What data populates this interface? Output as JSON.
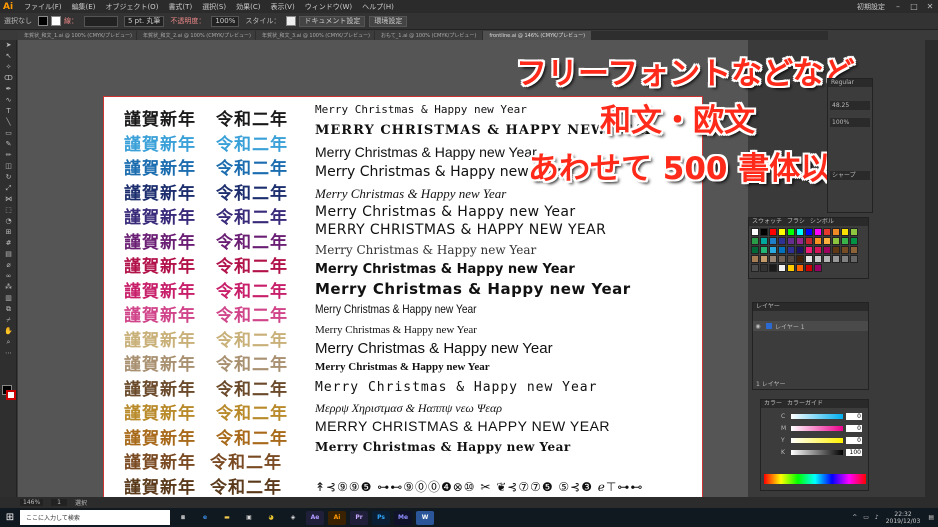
{
  "app": {
    "logo": "Ai",
    "menus": [
      "ファイル(F)",
      "編集(E)",
      "オブジェクト(O)",
      "書式(T)",
      "選択(S)",
      "効果(C)",
      "表示(V)",
      "ウィンドウ(W)",
      "ヘルプ(H)"
    ],
    "workspace": "初期設定"
  },
  "control": {
    "selection": "選択なし",
    "stroke_label": "線：",
    "stroke_value": "5 pt. 丸筆",
    "opacity_label": "不透明度：",
    "opacity_value": "100%",
    "style_label": "スタイル：",
    "doc_setup": "ドキュメント設定",
    "prefs": "環境設定"
  },
  "tabs": [
    "年賀状_和文_1.ai @ 100% (CMYK/プレビュー)",
    "年賀状_和文_2.ai @ 100% (CMYK/プレビュー)",
    "年賀状_和文_3.ai @ 100% (CMYK/プレビュー)",
    "おもて_1.ai @ 100% (CMYK/プレビュー)",
    "frontline.ai @ 146% (CMYK/プレビュー)"
  ],
  "artboard": {
    "jp_left": [
      {
        "text": "謹賀新年",
        "color": "#1a1a1a"
      },
      {
        "text": "謹賀新年",
        "color": "#3aa0d8"
      },
      {
        "text": "謹賀新年",
        "color": "#1b6db0"
      },
      {
        "text": "謹賀新年",
        "color": "#1d2e6e"
      },
      {
        "text": "謹賀新年",
        "color": "#3a2a7a"
      },
      {
        "text": "謹賀新年",
        "color": "#6a1f74"
      },
      {
        "text": "謹賀新年",
        "color": "#b2124a"
      },
      {
        "text": "謹賀新年",
        "color": "#c71f6a"
      },
      {
        "text": "謹賀新年",
        "color": "#d0448a"
      },
      {
        "text": "謹賀新年",
        "color": "#c8b078"
      },
      {
        "text": "謹賀新年",
        "color": "#a89070"
      },
      {
        "text": "謹賀新年",
        "color": "#6a4a2a"
      },
      {
        "text": "謹賀新年",
        "color": "#b88a2a"
      },
      {
        "text": "謹賀新年",
        "color": "#a86a1a"
      },
      {
        "text": "謹賀新年",
        "color": "#7a4a22"
      },
      {
        "text": "謹賀新年",
        "color": "#5a3a1a"
      },
      {
        "text": "謹賀新年",
        "color": "#3a2a1a"
      }
    ],
    "jp_right": [
      {
        "text": "令和二年",
        "color": "#1a1a1a"
      },
      {
        "text": "令和二年",
        "color": "#3aa0d8"
      },
      {
        "text": "令和二年",
        "color": "#1b6db0"
      },
      {
        "text": "令和二年",
        "color": "#1d2e6e"
      },
      {
        "text": "令和二年",
        "color": "#3a2a7a"
      },
      {
        "text": "令和二年",
        "color": "#6a1f74"
      },
      {
        "text": "令和二年",
        "color": "#b2124a"
      },
      {
        "text": "令和二年",
        "color": "#c71f6a"
      },
      {
        "text": "令和二年",
        "color": "#d0448a"
      },
      {
        "text": "令和二年",
        "color": "#c8b078"
      },
      {
        "text": "令和二年",
        "color": "#a89070"
      },
      {
        "text": "令和二年",
        "color": "#6a4a2a"
      },
      {
        "text": "令和二年",
        "color": "#b88a2a"
      },
      {
        "text": "令和二年",
        "color": "#a86a1a"
      },
      {
        "text": "令和二年",
        "color": "#7a4a22"
      },
      {
        "text": "令和二年",
        "color": "#5a3a1a"
      },
      {
        "text": "令和二年",
        "color": "#3a2a1a"
      }
    ],
    "english": [
      "Merry Christmas &  Happy new Year",
      "MERRY CHRISTMAS & HAPPY NEW YEAR",
      "Merry Christmas & Happy new Year",
      "Merry Christmas & Happy new Year",
      "Merry Christmas & Happy new Year",
      "Merry Christmas & Happy new Year",
      "MERRY CHRISTMAS & HAPPY NEW YEAR",
      "Merry Christmas & Happy new Year",
      "Merry Christmas & Happy new Year",
      "Merry Christmas & Happy new Year",
      "Merry Christmas & Happy new Year",
      "Merry Christmas & Happy new Year",
      "Merry Christmas & Happy new Year",
      "Merry Christmas & Happy new Year",
      "Merry Christmas & Happy new Year",
      "Μερρψ Χηριστμασ & Ηαππψ νεω Ψεαρ",
      "MERRY CHRISTMAS & HAPPY NEW YEAR",
      "Merry Christmas & Happy new Year"
    ],
    "dingbats_1": "↟⊰⑨⑨❺   ⊶⊷⑨⓪⓪❹⊗⑩   ✂   ❦⊰⑦⑦❺   ⑤⊰❸   ℯ⊤⊶⊷",
    "dingbats_2": "↺⇨△△◢   ⇤↑△↓▽◀⊳▷   ↗   ⇆⇨▲▲◢   ⇔⇨▷   ∰⊰∰"
  },
  "overlay": {
    "line1": "フリーフォントなどなど",
    "line2": "和文・欧文",
    "line3": "あわせて 500 書体以上"
  },
  "panels": {
    "regular": "Regular",
    "font_size": "48.25",
    "tracking": "100%",
    "sharp": "シャープ",
    "swatches_tabs": [
      "スウォッチ",
      "ブラシ",
      "シンボル"
    ],
    "layers_title": "レイヤー",
    "layer_name": "レイヤー 1",
    "layer_count": "1 レイヤー",
    "color_tabs": [
      "カラー",
      "カラーガイド"
    ],
    "cmyk": [
      {
        "ch": "C",
        "val": "0"
      },
      {
        "ch": "M",
        "val": "0"
      },
      {
        "ch": "Y",
        "val": "0"
      },
      {
        "ch": "K",
        "val": "100"
      }
    ]
  },
  "status": {
    "zoom": "146%",
    "page": "1",
    "tool": "選択"
  },
  "taskbar": {
    "search_placeholder": "ここに入力して検索",
    "time": "22:32",
    "date": "2019/12/03"
  }
}
